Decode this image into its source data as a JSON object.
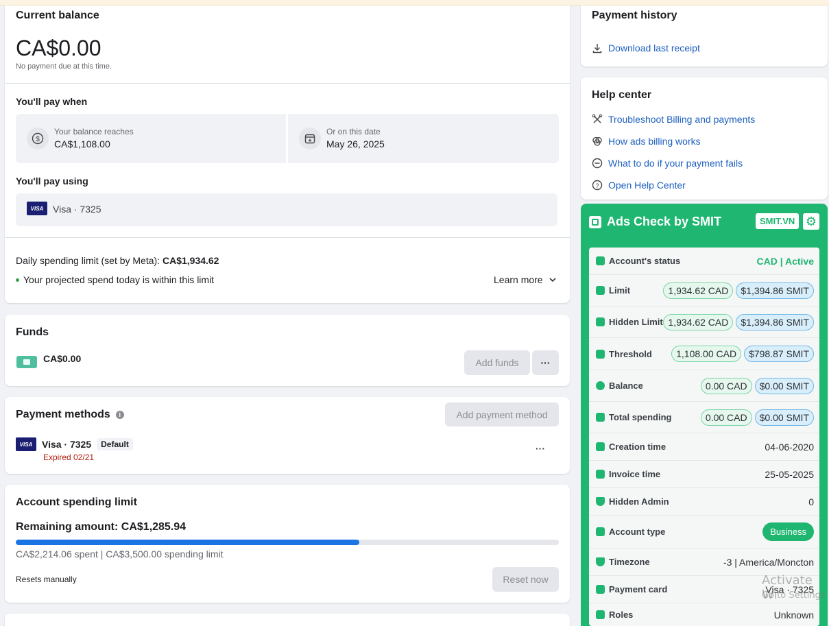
{
  "balance": {
    "title": "Current balance",
    "amount": "CA$0.00",
    "note": "No payment due at this time.",
    "pay_when_title": "You'll pay when",
    "threshold_label": "Your balance reaches",
    "threshold_value": "CA$1,108.00",
    "date_label": "Or on this date",
    "date_value": "May 26, 2025",
    "pay_using_title": "You'll pay using",
    "card_brand": "VISA",
    "card_label": "Visa · 7325",
    "daily_limit_label": "Daily spending limit (set by Meta):",
    "daily_limit_value": "CA$1,934.62",
    "projected_note": "Your projected spend today is within this limit",
    "learn_more": "Learn more"
  },
  "funds": {
    "title": "Funds",
    "amount": "CA$0.00",
    "add_funds": "Add funds",
    "more": "···"
  },
  "payment_methods": {
    "title": "Payment methods",
    "add_button": "Add payment method",
    "card_brand": "VISA",
    "card_label": "Visa · 7325",
    "default_badge": "Default",
    "expired": "Expired 02/21",
    "more": "···"
  },
  "account_limit": {
    "title": "Account spending limit",
    "remaining": "Remaining amount: CA$1,285.94",
    "progress_fraction": 0.6326,
    "spent_note": "CA$2,214.06 spent | CA$3,500.00 spending limit",
    "resets": "Resets manually",
    "reset_button": "Reset now"
  },
  "payment_history": {
    "title": "Payment history",
    "download": "Download last receipt"
  },
  "help_center": {
    "title": "Help center",
    "links": [
      {
        "label": "Troubleshoot Billing and payments",
        "icon": "tools-icon"
      },
      {
        "label": "How ads billing works",
        "icon": "venn-icon"
      },
      {
        "label": "What to do if your payment fails",
        "icon": "minus-circle-icon"
      },
      {
        "label": "Open Help Center",
        "icon": "question-icon"
      }
    ]
  },
  "smit": {
    "title": "Ads Check by SMIT",
    "badge": "SMIT.VN",
    "accent": "#1fb671",
    "rows": {
      "status": {
        "label": "Account's status",
        "value": "CAD | Active"
      },
      "limit": {
        "label": "Limit",
        "cad": "1,934.62 CAD",
        "smit": "$1,394.86 SMIT"
      },
      "hidden_limit": {
        "label": "Hidden Limit",
        "cad": "1,934.62 CAD",
        "smit": "$1,394.86 SMIT"
      },
      "threshold": {
        "label": "Threshold",
        "cad": "1,108.00 CAD",
        "smit": "$798.87 SMIT"
      },
      "balance": {
        "label": "Balance",
        "cad": "0.00 CAD",
        "smit": "$0.00 SMIT"
      },
      "total_spending": {
        "label": "Total spending",
        "cad": "0.00 CAD",
        "smit": "$0.00 SMIT"
      },
      "creation_time": {
        "label": "Creation time",
        "value": "04-06-2020"
      },
      "invoice_time": {
        "label": "Invoice time",
        "value": "25-05-2025"
      },
      "hidden_admin": {
        "label": "Hidden Admin",
        "value": "0"
      },
      "account_type": {
        "label": "Account type",
        "value": "Business"
      },
      "timezone": {
        "label": "Timezone",
        "value": "-3 | America/Moncton"
      },
      "payment_card": {
        "label": "Payment card",
        "value": "Visa · 7325"
      },
      "roles": {
        "label": "Roles",
        "value": "Unknown"
      }
    }
  },
  "watermark": {
    "line1": "Activate Wi",
    "line2": "Go to Settings"
  }
}
